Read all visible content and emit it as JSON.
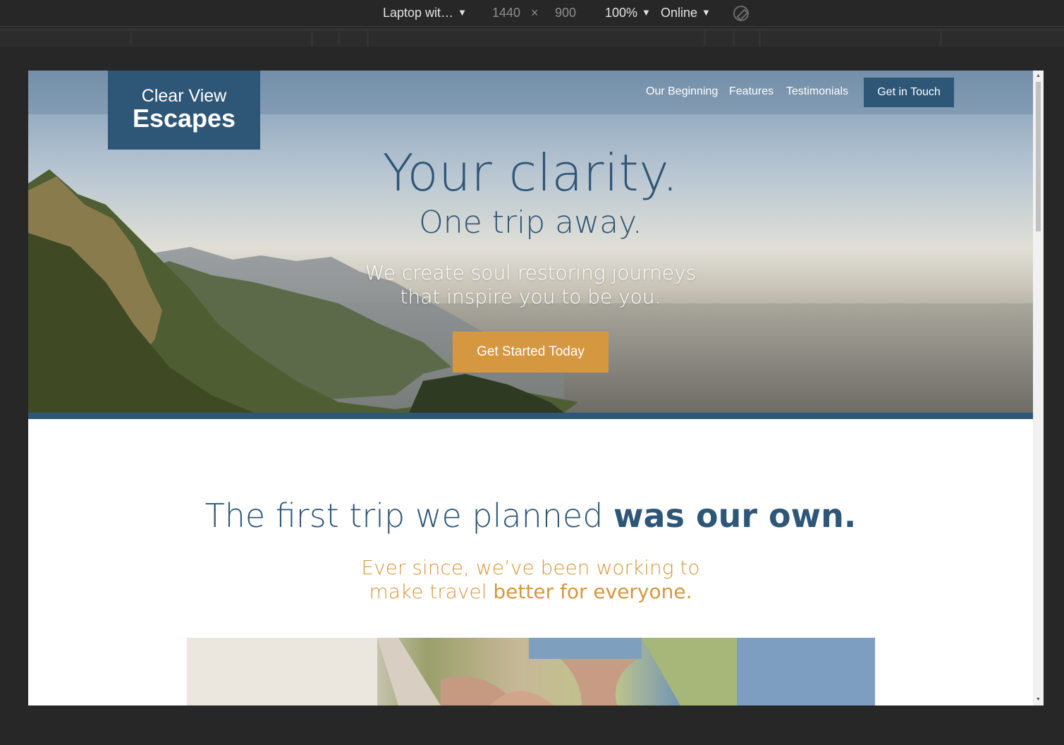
{
  "devtools": {
    "device": "Laptop wit…",
    "width": "1440",
    "times": "×",
    "height": "900",
    "zoom": "100%",
    "network": "Online",
    "caret": "▼"
  },
  "site": {
    "logo": {
      "line1": "Clear View",
      "line2": "Escapes"
    },
    "nav": {
      "items": [
        "Our Beginning",
        "Features",
        "Testimonials"
      ],
      "cta": "Get in Touch"
    },
    "hero": {
      "title": "Your clarity.",
      "subtitle": "One trip away.",
      "tagline_line1": "We create soul restoring journeys",
      "tagline_line2": "that inspire you to be you.",
      "button": "Get Started Today"
    },
    "section2": {
      "heading_light": "The first trip we planned",
      "heading_bold": "was our own.",
      "sub_line1": "Ever since, we’ve been working to",
      "sub_line2_light": "make travel",
      "sub_line2_bold": "better for everyone."
    }
  },
  "colors": {
    "primary": "#2e5677",
    "accent": "#d59840",
    "devtools_bg": "#272727"
  }
}
